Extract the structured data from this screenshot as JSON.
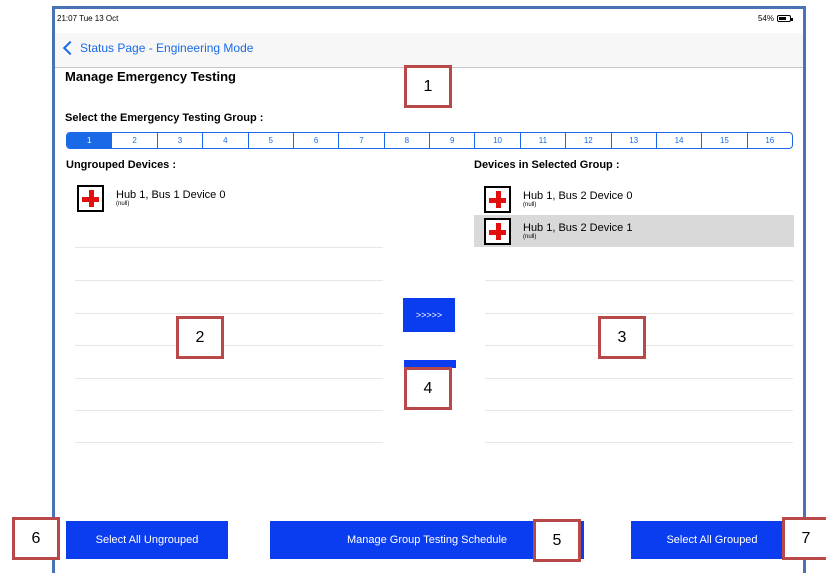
{
  "status_bar": {
    "time": "21:07  Tue 13 Oct",
    "battery": "54%"
  },
  "nav": {
    "back_label": "Status Page - Engineering Mode"
  },
  "page": {
    "title": "Manage Emergency Testing",
    "group_select_label": "Select the Emergency Testing Group :"
  },
  "groups": {
    "tabs": [
      "1",
      "2",
      "3",
      "4",
      "5",
      "6",
      "7",
      "8",
      "9",
      "10",
      "11",
      "12",
      "13",
      "14",
      "15",
      "16"
    ],
    "selected": "1"
  },
  "ungrouped": {
    "header": "Ungrouped Devices :",
    "devices": [
      {
        "name": "Hub 1, Bus 1 Device 0",
        "sub": "(null)"
      }
    ]
  },
  "grouped": {
    "header": "Devices in Selected Group :",
    "devices": [
      {
        "name": "Hub 1, Bus 2 Device 0",
        "sub": "(null)",
        "selected": false
      },
      {
        "name": "Hub 1, Bus 2 Device 1",
        "sub": "(null)",
        "selected": true
      }
    ]
  },
  "actions": {
    "move_right_label": ">>>>>",
    "select_all_ungrouped": "Select All Ungrouped",
    "manage_schedule": "Manage  Group Testing Schedule",
    "select_all_grouped": "Select All Grouped"
  },
  "callouts": [
    "1",
    "2",
    "3",
    "4",
    "5",
    "6",
    "7"
  ],
  "colors": {
    "accent_blue": "#1a6ae8",
    "button_blue": "#0a3cf0",
    "callout_border": "#b94848",
    "frame_border": "#4a73b5"
  }
}
